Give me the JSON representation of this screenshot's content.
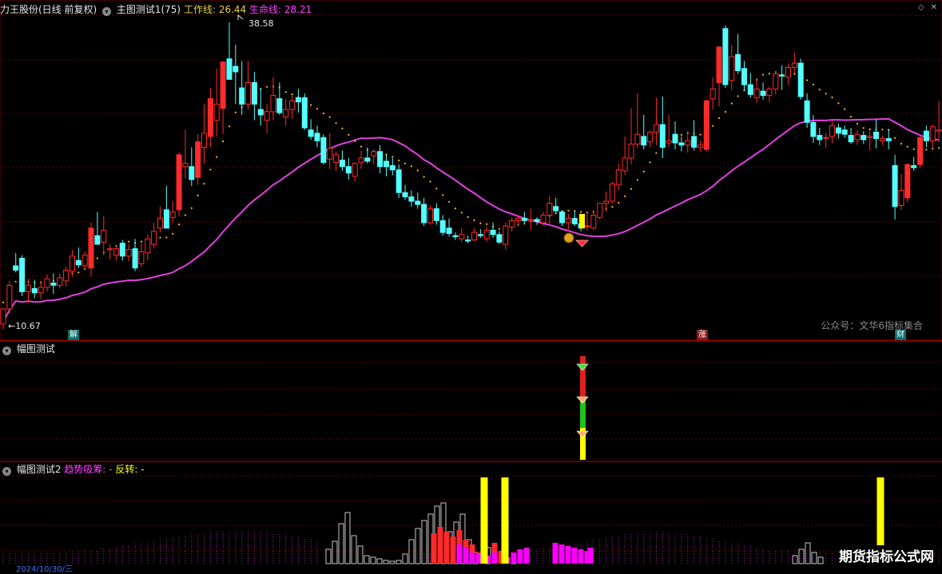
{
  "main_header": {
    "title": "力王股份(日线 前复权)",
    "indicator": "主图测试1(75)",
    "work_line_label": "工作线:",
    "work_line_value": "26.44",
    "life_line_label": "生命线:",
    "life_line_value": "28.21"
  },
  "panel2_header": {
    "title": "幅图测试"
  },
  "panel3_header": {
    "title": "幅图测试2",
    "trend_label": "趋势吸筹:",
    "trend_value": "-",
    "reversal_label": "反转:",
    "reversal_value": "-"
  },
  "watermark": "公众号：文华6指标集合",
  "brand": "期货指标公式网",
  "date_fragment": "2024/10/30/三",
  "signal_tags": [
    "解",
    "涨",
    "财"
  ],
  "colors": {
    "up": "#ff2a2a",
    "down": "#54ffff",
    "work_line": "#ffc020",
    "life_line": "#e040e0",
    "grid": "#8b0000",
    "signal_yellow": "#ffff00",
    "magenta_bar": "#ff00ff"
  },
  "chart_data": [
    {
      "type": "candlestick",
      "title": "力王股份(日线 前复权)",
      "annotations": {
        "high": "38.58",
        "low": "10.67"
      },
      "series": [
        {
          "name": "工作线",
          "type": "dotted-line"
        },
        {
          "name": "生命线",
          "type": "line"
        }
      ],
      "candles": [
        [
          10.6,
          12.1,
          10.1,
          12.0
        ],
        [
          12.0,
          14.6,
          11.6,
          14.2
        ],
        [
          16.0,
          17.2,
          15.4,
          15.6
        ],
        [
          16.7,
          17.0,
          13.2,
          13.6
        ],
        [
          13.6,
          14.8,
          12.6,
          14.2
        ],
        [
          13.9,
          14.7,
          13.0,
          13.5
        ],
        [
          13.5,
          14.6,
          12.9,
          14.0
        ],
        [
          14.0,
          15.2,
          13.6,
          14.8
        ],
        [
          14.4,
          15.3,
          13.4,
          14.2
        ],
        [
          14.2,
          15.3,
          13.9,
          14.9
        ],
        [
          14.6,
          15.9,
          14.1,
          15.6
        ],
        [
          15.5,
          17.5,
          15.0,
          16.9
        ],
        [
          16.5,
          17.7,
          15.8,
          16.1
        ],
        [
          16.0,
          17.3,
          15.7,
          17.0
        ],
        [
          15.8,
          20.0,
          15.0,
          19.5
        ],
        [
          18.8,
          21.0,
          18.0,
          18.0
        ],
        [
          18.2,
          20.6,
          17.0,
          19.3
        ],
        [
          17.5,
          18.0,
          16.6,
          17.6
        ],
        [
          17.0,
          17.9,
          16.5,
          17.6
        ],
        [
          18.1,
          18.4,
          16.5,
          16.9
        ],
        [
          16.9,
          18.0,
          16.4,
          17.5
        ],
        [
          17.6,
          18.5,
          15.5,
          15.8
        ],
        [
          16.2,
          18.1,
          15.9,
          17.3
        ],
        [
          17.2,
          18.9,
          16.5,
          18.5
        ],
        [
          18.0,
          20.0,
          17.6,
          19.2
        ],
        [
          19.5,
          21.5,
          19.1,
          20.4
        ],
        [
          21.2,
          23.4,
          19.5,
          19.5
        ],
        [
          20.5,
          22.0,
          20.0,
          21.0
        ],
        [
          21.2,
          26.5,
          20.6,
          26.3
        ],
        [
          25.2,
          28.6,
          24.1,
          25.5
        ],
        [
          25.2,
          27.0,
          23.4,
          24.0
        ],
        [
          24.2,
          28.2,
          23.5,
          27.5
        ],
        [
          27.0,
          31.0,
          25.5,
          28.3
        ],
        [
          28.0,
          32.5,
          27.0,
          31.5
        ],
        [
          29.5,
          34.3,
          28.0,
          31.0
        ],
        [
          30.6,
          35.0,
          28.2,
          34.9
        ],
        [
          35.2,
          38.6,
          33.5,
          33.3
        ],
        [
          34.5,
          36.5,
          31.0,
          34.0
        ],
        [
          32.5,
          35.0,
          30.0,
          31.0
        ],
        [
          31.0,
          35.0,
          30.5,
          33.0
        ],
        [
          33.0,
          34.0,
          29.5,
          31.0
        ],
        [
          30.5,
          32.5,
          29.0,
          30.0
        ],
        [
          29.5,
          31.0,
          28.3,
          30.3
        ],
        [
          30.3,
          33.5,
          29.5,
          31.8
        ],
        [
          31.5,
          33.0,
          30.0,
          30.2
        ],
        [
          29.8,
          31.5,
          29.0,
          30.5
        ],
        [
          30.5,
          31.8,
          29.6,
          31.3
        ],
        [
          31.6,
          32.4,
          30.2,
          31.2
        ],
        [
          31.6,
          32.0,
          28.6,
          28.8
        ],
        [
          28.6,
          29.6,
          27.7,
          28.0
        ],
        [
          28.3,
          29.0,
          27.0,
          27.6
        ],
        [
          27.9,
          28.2,
          25.4,
          25.6
        ],
        [
          25.9,
          28.3,
          25.0,
          26.9
        ],
        [
          25.6,
          26.6,
          24.8,
          26.3
        ],
        [
          25.8,
          26.7,
          24.8,
          25.2
        ],
        [
          25.2,
          26.0,
          24.0,
          24.6
        ],
        [
          24.3,
          25.6,
          23.8,
          25.5
        ],
        [
          25.6,
          26.7,
          25.0,
          26.0
        ],
        [
          26.0,
          27.0,
          25.5,
          25.7
        ],
        [
          26.2,
          26.8,
          25.4,
          26.6
        ],
        [
          26.6,
          27.2,
          24.6,
          25.2
        ],
        [
          25.7,
          26.3,
          24.3,
          25.2
        ],
        [
          25.3,
          26.0,
          24.4,
          24.9
        ],
        [
          24.9,
          25.4,
          22.3,
          22.8
        ],
        [
          22.8,
          23.5,
          22.1,
          22.4
        ],
        [
          22.4,
          23.0,
          21.5,
          22.0
        ],
        [
          22.0,
          22.8,
          21.3,
          21.7
        ],
        [
          21.7,
          22.3,
          19.7,
          20.0
        ],
        [
          20.0,
          21.6,
          19.8,
          21.3
        ],
        [
          21.3,
          21.8,
          19.8,
          20.2
        ],
        [
          20.2,
          20.7,
          18.8,
          19.1
        ],
        [
          19.5,
          20.4,
          18.7,
          19.0
        ],
        [
          18.8,
          19.1,
          18.4,
          18.7
        ],
        [
          18.5,
          19.5,
          18.2,
          18.9
        ],
        [
          18.4,
          18.8,
          18.1,
          18.3
        ],
        [
          18.4,
          19.5,
          18.3,
          19.1
        ],
        [
          18.9,
          19.4,
          18.6,
          18.8
        ],
        [
          18.5,
          19.6,
          18.2,
          19.3
        ],
        [
          19.3,
          20.0,
          18.6,
          18.9
        ],
        [
          18.9,
          19.2,
          18.0,
          18.2
        ],
        [
          18.0,
          20.0,
          17.5,
          19.7
        ],
        [
          19.6,
          20.5,
          19.2,
          20.2
        ],
        [
          20.2,
          20.6,
          19.7,
          20.4
        ],
        [
          20.4,
          21.0,
          20.0,
          20.2
        ],
        [
          20.2,
          21.3,
          19.3,
          20.3
        ],
        [
          20.3,
          20.5,
          19.8,
          20.1
        ],
        [
          20.0,
          21.0,
          19.7,
          20.7
        ],
        [
          20.7,
          22.5,
          19.9,
          21.8
        ],
        [
          21.5,
          22.3,
          20.9,
          21.1
        ],
        [
          21.0,
          21.2,
          19.7,
          20.0
        ],
        [
          20.0,
          20.8,
          19.4,
          20.4
        ],
        [
          20.4,
          21.1,
          19.7,
          19.9
        ],
        [
          19.9,
          20.6,
          19.2,
          19.5
        ],
        [
          19.7,
          21.0,
          19.3,
          19.7
        ],
        [
          19.5,
          21.2,
          19.3,
          20.7
        ],
        [
          20.5,
          21.8,
          20.3,
          21.8
        ],
        [
          21.8,
          22.9,
          21.0,
          22.0
        ],
        [
          22.0,
          23.8,
          21.8,
          23.6
        ],
        [
          23.5,
          25.5,
          23.0,
          24.9
        ],
        [
          24.8,
          28.0,
          24.4,
          26.0
        ],
        [
          26.0,
          30.6,
          25.4,
          27.3
        ],
        [
          27.3,
          32.0,
          26.9,
          28.2
        ],
        [
          28.0,
          30.0,
          26.8,
          27.2
        ],
        [
          27.5,
          28.5,
          27.0,
          28.4
        ],
        [
          28.4,
          31.6,
          27.2,
          29.1
        ],
        [
          29.1,
          31.7,
          26.0,
          27.0
        ],
        [
          27.4,
          30.0,
          27.0,
          27.6
        ],
        [
          28.2,
          29.4,
          26.8,
          27.4
        ],
        [
          27.4,
          28.0,
          26.6,
          27.2
        ],
        [
          27.2,
          28.5,
          26.5,
          27.6
        ],
        [
          28.0,
          29.5,
          26.7,
          27.0
        ],
        [
          27.0,
          27.6,
          26.6,
          27.2
        ],
        [
          26.8,
          31.4,
          26.6,
          31.3
        ],
        [
          31.5,
          33.5,
          30.5,
          32.4
        ],
        [
          33.0,
          36.3,
          30.8,
          36.3
        ],
        [
          38.0,
          38.3,
          32.5,
          32.8
        ],
        [
          33.2,
          36.5,
          32.3,
          35.4
        ],
        [
          35.6,
          37.5,
          33.8,
          34.1
        ],
        [
          34.3,
          35.0,
          32.2,
          32.8
        ],
        [
          32.8,
          33.9,
          31.6,
          31.9
        ],
        [
          31.6,
          33.4,
          31.1,
          32.4
        ],
        [
          32.2,
          33.0,
          31.4,
          31.8
        ],
        [
          31.8,
          32.6,
          31.2,
          32.4
        ],
        [
          32.4,
          34.0,
          31.9,
          33.8
        ],
        [
          33.7,
          34.6,
          32.3,
          33.6
        ],
        [
          33.5,
          34.7,
          32.8,
          34.4
        ],
        [
          34.4,
          35.8,
          33.9,
          34.8
        ],
        [
          34.8,
          35.2,
          31.4,
          31.7
        ],
        [
          31.3,
          32.0,
          28.8,
          29.3
        ],
        [
          29.3,
          30.0,
          27.4,
          28.0
        ],
        [
          28.1,
          28.8,
          27.2,
          27.7
        ],
        [
          27.9,
          28.3,
          26.9,
          27.9
        ],
        [
          28.0,
          29.5,
          27.4,
          29.0
        ],
        [
          28.8,
          29.2,
          27.8,
          28.3
        ],
        [
          28.6,
          29.0,
          27.9,
          28.2
        ],
        [
          28.1,
          28.8,
          27.3,
          27.5
        ],
        [
          27.7,
          28.6,
          27.2,
          28.2
        ],
        [
          28.1,
          28.5,
          27.3,
          27.7
        ],
        [
          27.9,
          28.5,
          26.7,
          28.0
        ],
        [
          28.4,
          29.6,
          26.9,
          27.8
        ],
        [
          27.6,
          28.1,
          27.2,
          27.8
        ],
        [
          27.8,
          28.7,
          26.8,
          27.6
        ],
        [
          25.3,
          26.3,
          20.3,
          21.5
        ],
        [
          21.6,
          24.5,
          21.2,
          23.0
        ],
        [
          22.3,
          25.5,
          21.9,
          25.4
        ],
        [
          25.3,
          26.1,
          24.8,
          25.1
        ],
        [
          25.4,
          28.1,
          25.1,
          27.9
        ],
        [
          28.5,
          29.0,
          27.0,
          27.6
        ],
        [
          27.6,
          29.1,
          27.0,
          28.9
        ],
        [
          28.5,
          31.3,
          27.5,
          28.6
        ]
      ]
    },
    {
      "type": "bar",
      "title": "幅图测试",
      "signal_bar": {
        "segments": [
          "yellow",
          "orange",
          "green",
          "red"
        ]
      }
    },
    {
      "type": "bar",
      "title": "幅图测试2",
      "series": [
        {
          "name": "趋势吸筹",
          "color": "#ff00ff"
        },
        {
          "name": "反转",
          "color": "#ffff00"
        }
      ]
    }
  ]
}
